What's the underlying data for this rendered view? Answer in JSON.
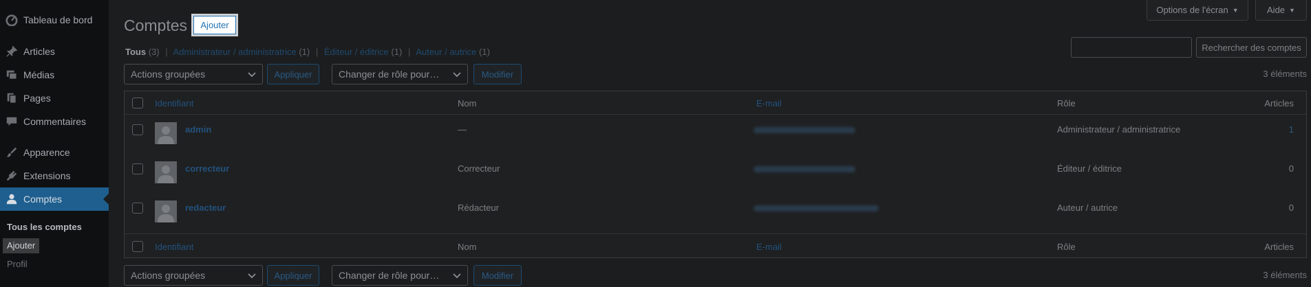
{
  "sidebar": {
    "items": [
      {
        "label": "Tableau de bord",
        "icon": "dashboard-icon"
      },
      {
        "label": "Articles",
        "icon": "pin-icon"
      },
      {
        "label": "Médias",
        "icon": "media-icon"
      },
      {
        "label": "Pages",
        "icon": "pages-icon"
      },
      {
        "label": "Commentaires",
        "icon": "comment-icon"
      },
      {
        "label": "Apparence",
        "icon": "brush-icon"
      },
      {
        "label": "Extensions",
        "icon": "plugin-icon"
      },
      {
        "label": "Comptes",
        "icon": "user-icon",
        "active": true
      }
    ],
    "submenu": [
      {
        "label": "Tous les comptes"
      },
      {
        "label": "Ajouter"
      },
      {
        "label": "Profil"
      }
    ]
  },
  "header": {
    "title": "Comptes",
    "add_label": "Ajouter",
    "screen_options_label": "Options de l'écran",
    "help_label": "Aide"
  },
  "filters": {
    "all_label": "Tous",
    "all_count": "(3)",
    "admin_label": "Administrateur / administratrice",
    "admin_count": "(1)",
    "editor_label": "Éditeur / éditrice",
    "editor_count": "(1)",
    "author_label": "Auteur / autrice",
    "author_count": "(1)"
  },
  "search": {
    "button_label": "Rechercher des comptes"
  },
  "bulk": {
    "actions_label": "Actions groupées",
    "apply_label": "Appliquer",
    "role_label": "Changer de rôle pour…",
    "modify_label": "Modifier",
    "count_label": "3 éléments"
  },
  "table": {
    "columns": {
      "username": "Identifiant",
      "name": "Nom",
      "email": "E-mail",
      "role": "Rôle",
      "posts": "Articles"
    },
    "rows": [
      {
        "username": "admin",
        "name": "—",
        "role": "Administrateur / administratrice",
        "posts": "1"
      },
      {
        "username": "correcteur",
        "name": "Correcteur",
        "role": "Éditeur / éditrice",
        "posts": "0"
      },
      {
        "username": "redacteur",
        "name": "Rédacteur",
        "role": "Auteur / autrice",
        "posts": "0"
      }
    ]
  },
  "colors": {
    "accent": "#2271b1",
    "active_menu": "#1e5f8f"
  }
}
